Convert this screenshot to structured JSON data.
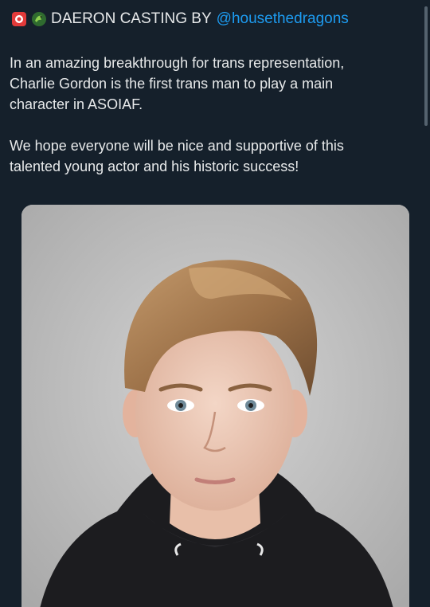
{
  "tweet": {
    "headline": "DAERON CASTING BY",
    "mention": "@housethedragons",
    "icons": [
      "rose-emoji-icon",
      "dragon-emoji-icon"
    ],
    "paragraphs": [
      "In an amazing breakthrough for trans representation,\nCharlie Gordon is the first trans man to play a main\ncharacter in ASOIAF.",
      "We hope everyone will be nice and supportive of this\ntalented young actor and his historic success!"
    ]
  },
  "colors": {
    "background": "#15202b",
    "text": "#e7e9ea",
    "link": "#1d9bf0"
  }
}
